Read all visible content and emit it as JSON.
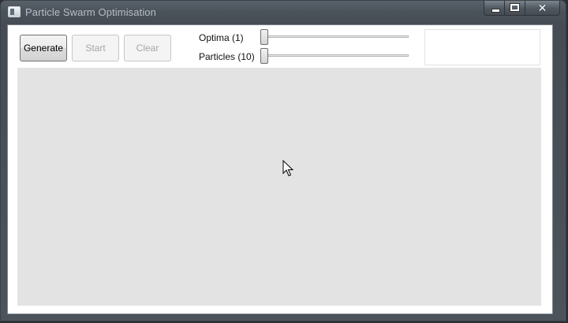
{
  "window": {
    "title": "Particle Swarm Optimisation",
    "caption_icons": [
      "minimize-icon",
      "maximize-icon",
      "close-icon"
    ],
    "close_glyph": "✕"
  },
  "toolbar": {
    "generate_label": "Generate",
    "start_label": "Start",
    "clear_label": "Clear"
  },
  "sliders": {
    "optima": {
      "label": "Optima  (1)",
      "value": 1,
      "fraction": 0.0
    },
    "particles": {
      "label": "Particles (10)",
      "value": 10,
      "fraction": 0.0
    }
  },
  "colors": {
    "canvas": "#e4e3e4",
    "window_frame": "#4a525a",
    "disabled_text": "#a6a6a6"
  }
}
